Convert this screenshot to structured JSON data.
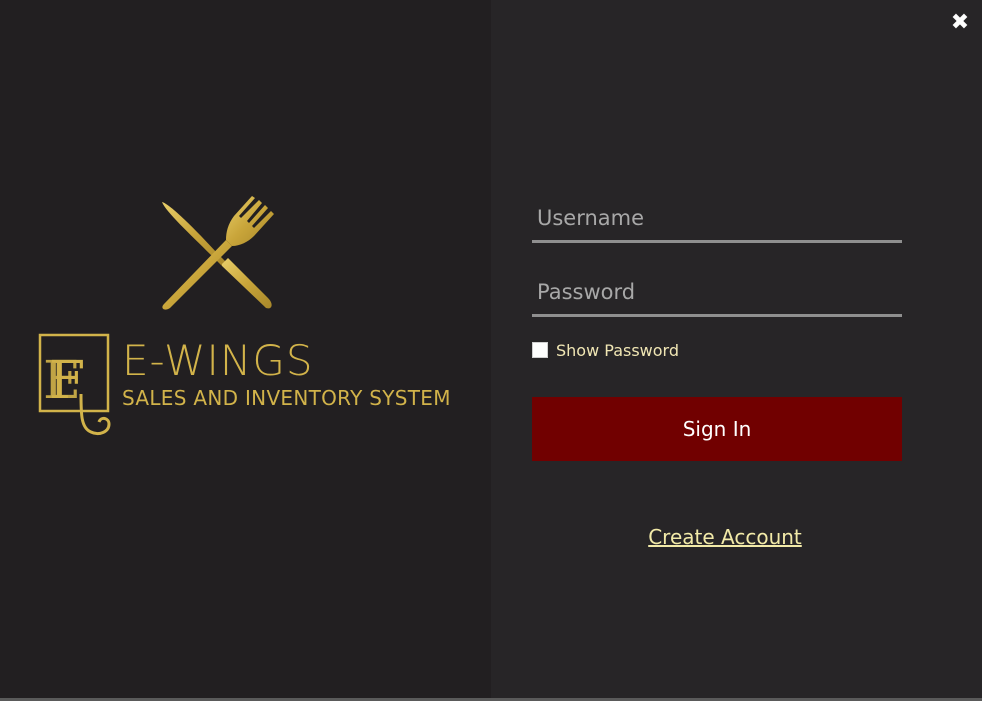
{
  "window": {
    "close_glyph": "✖"
  },
  "brand": {
    "name": "E-WINGS",
    "tagline": "SALES AND INVENTORY SYSTEM",
    "gold_color": "#d2b34a",
    "logo_icon": "knife-fork-icon",
    "monogram_icon": "ef-monogram-icon"
  },
  "login": {
    "username_placeholder": "Username",
    "username_value": "",
    "password_placeholder": "Password",
    "password_value": "",
    "show_password_label": "Show Password",
    "show_password_checked": false,
    "signin_label": "Sign In",
    "signin_color": "#710000",
    "create_account_label": "Create Account"
  }
}
